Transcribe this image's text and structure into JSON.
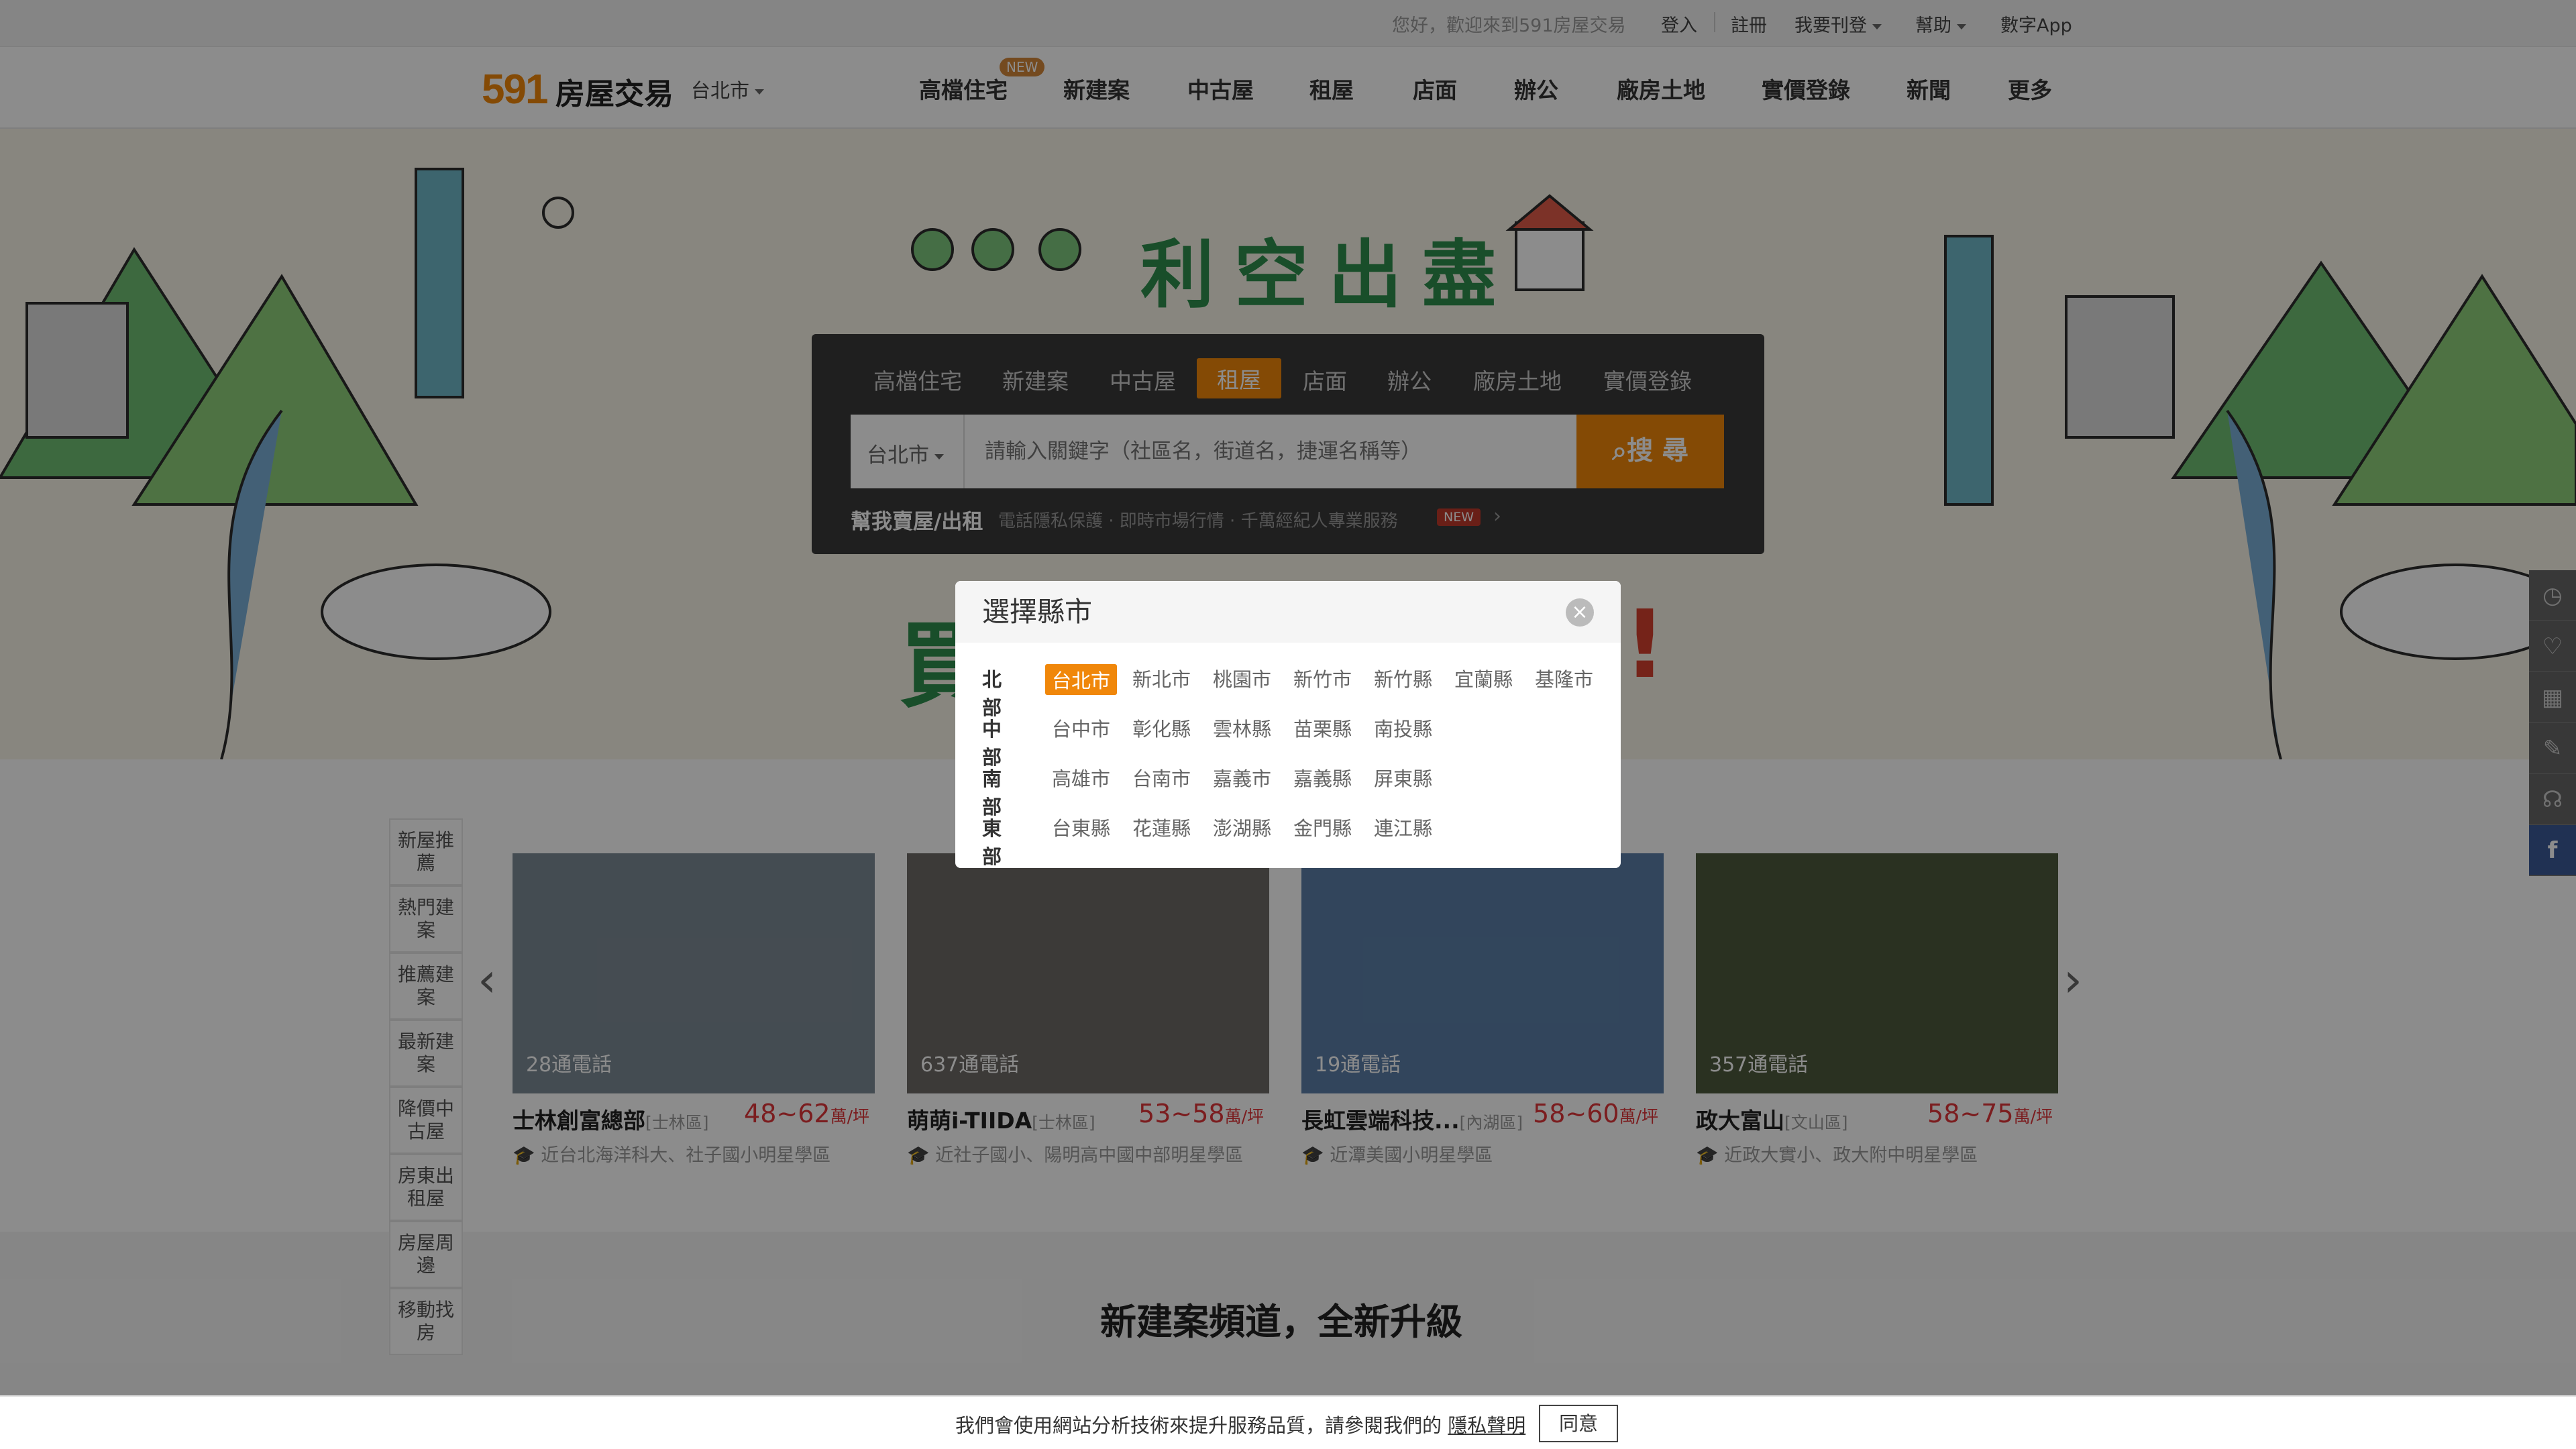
{
  "topbar": {
    "welcome": "您好，歡迎來到591房屋交易",
    "login": "登入",
    "register": "註冊",
    "post": "我要刊登",
    "help": "幫助",
    "app": "數字App"
  },
  "header": {
    "logo_number": "591",
    "logo_text": "房屋交易",
    "city": "台北市",
    "nav": [
      "高檔住宅",
      "新建案",
      "中古屋",
      "租屋",
      "店面",
      "辦公",
      "廠房土地",
      "實價登錄",
      "新聞",
      "更多"
    ],
    "new_badge": "NEW"
  },
  "banner": {
    "slogan": "利空出盡",
    "slogan2": "買",
    "exclaim": "!"
  },
  "search": {
    "tabs": [
      "高檔住宅",
      "新建案",
      "中古屋",
      "租屋",
      "店面",
      "辦公",
      "廠房土地",
      "實價登錄"
    ],
    "active_tab": "租屋",
    "city": "台北市",
    "placeholder": "請輸入關鍵字（社區名，街道名，捷運名稱等）",
    "button": "搜 尋",
    "help_label": "幫我賣屋/出租",
    "help_desc": "電話隱私保護 · 即時市場行情 · 千萬經紀人專業服務",
    "help_new": "NEW"
  },
  "modal": {
    "title": "選擇縣市",
    "close": "×",
    "regions": [
      {
        "name": "北部",
        "cities": [
          "台北市",
          "新北市",
          "桃園市",
          "新竹市",
          "新竹縣",
          "宜蘭縣",
          "基隆市"
        ]
      },
      {
        "name": "中部",
        "cities": [
          "台中市",
          "彰化縣",
          "雲林縣",
          "苗栗縣",
          "南投縣"
        ]
      },
      {
        "name": "南部",
        "cities": [
          "高雄市",
          "台南市",
          "嘉義市",
          "嘉義縣",
          "屏東縣"
        ]
      },
      {
        "name": "東部",
        "cities": [
          "台東縣",
          "花蓮縣",
          "澎湖縣",
          "金門縣",
          "連江縣"
        ]
      }
    ],
    "selected": "台北市"
  },
  "side_tabs": [
    "新屋推薦",
    "熱門建案",
    "推薦建案",
    "最新建案",
    "降價中古屋",
    "房東出租屋",
    "房屋周邊",
    "移動找房"
  ],
  "cards": [
    {
      "calls": "28通電話",
      "title": "士林創富總部",
      "district": "[士林區]",
      "price": "48~62",
      "unit": "萬/坪",
      "school": "近台北海洋科大、社子國小明星學區",
      "color": "#7d8a96"
    },
    {
      "calls": "637通電話",
      "title": "萌萌i-TIIDA",
      "district": "[士林區]",
      "price": "53~58",
      "unit": "萬/坪",
      "school": "近社子國小、陽明高中國中部明星學區",
      "color": "#6e6a66"
    },
    {
      "calls": "19通電話",
      "title": "長虹雲端科技...",
      "district": "[內湖區]",
      "price": "58~60",
      "unit": "萬/坪",
      "school": "近潭美國小明星學區",
      "color": "#5b7fa8"
    },
    {
      "calls": "357通電話",
      "title": "政大富山",
      "district": "[文山區]",
      "price": "58~75",
      "unit": "萬/坪",
      "school": "近政大實小、政大附中明星學區",
      "color": "#4d5a3c"
    }
  ],
  "section": {
    "title": "新建案頻道，全新升級"
  },
  "cookie": {
    "text": "我們會使用網站分析技術來提升服務品質，請參閱我們的",
    "link": "隱私聲明",
    "button": "同意"
  },
  "colors": {
    "accent": "#f0870a",
    "price": "#e0353a",
    "slogan": "#2f8f4e"
  }
}
